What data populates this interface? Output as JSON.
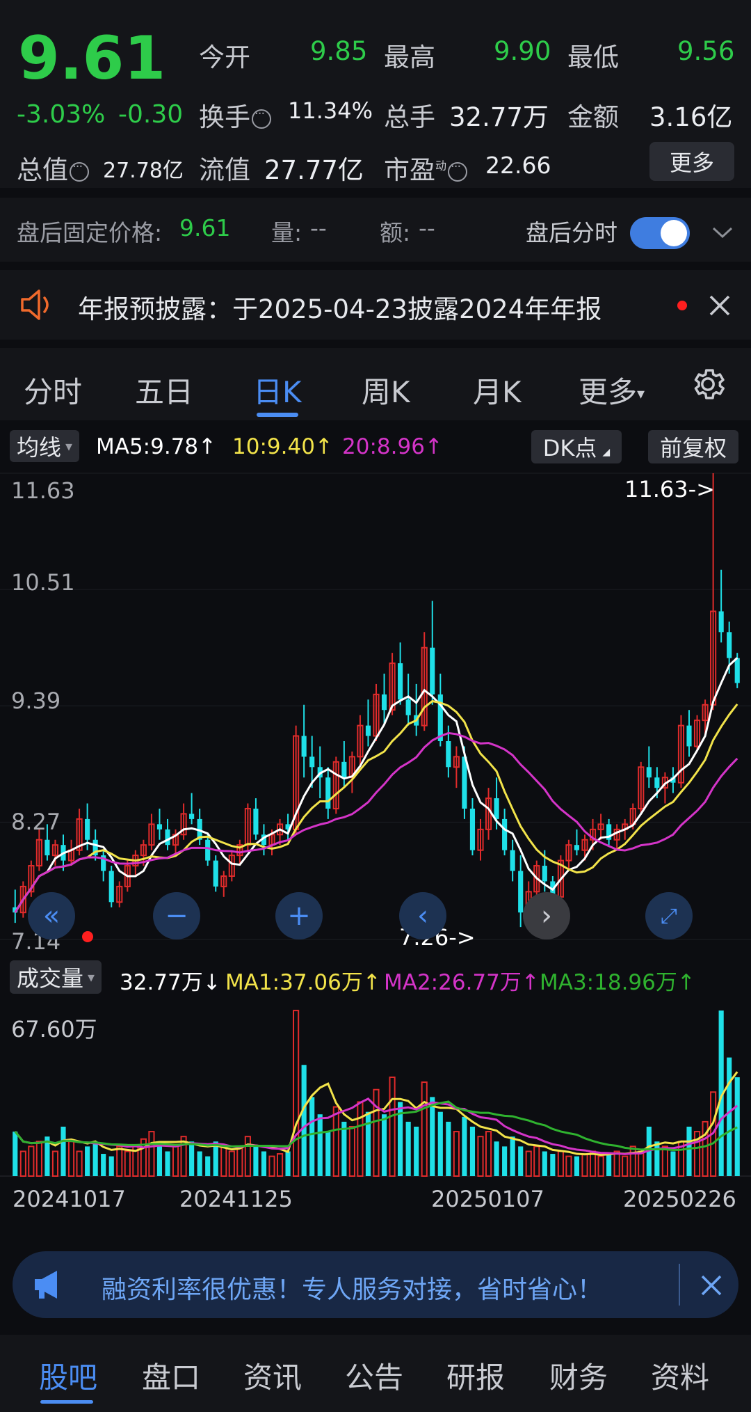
{
  "quote": {
    "price": "9.61",
    "change_pct": "-3.03%",
    "change_amt": "-0.30",
    "open_label": "今开",
    "open": "9.85",
    "high_label": "最高",
    "high": "9.90",
    "low_label": "最低",
    "low": "9.56",
    "turnover_label": "换手",
    "turnover": "11.34%",
    "volume_label": "总手",
    "volume": "32.77万",
    "amount_label": "金额",
    "amount": "3.16亿",
    "mktcap_label": "总值",
    "mktcap": "27.78亿",
    "float_label": "流值",
    "float": "27.77亿",
    "pe_label": "市盈",
    "pe_sup": "动",
    "pe": "22.66",
    "more_label": "更多"
  },
  "afterhours": {
    "price_label": "盘后固定价格:",
    "price": "9.61",
    "vol_label": "量:",
    "vol": "--",
    "amt_label": "额:",
    "amt": "--",
    "toggle_label": "盘后分时",
    "toggle_on": true
  },
  "notice": {
    "text": "年报预披露：于2025-04-23披露2024年年报"
  },
  "tabs": [
    {
      "label": "分时"
    },
    {
      "label": "五日"
    },
    {
      "label": "日K",
      "active": true
    },
    {
      "label": "周K"
    },
    {
      "label": "月K"
    },
    {
      "label": "更多"
    }
  ],
  "chart_controls": {
    "indicator_select": "均线",
    "ma5": "MA5:9.78",
    "ma10": "10:9.40",
    "ma20": "20:8.96",
    "dk_label": "DK点",
    "adjust_label": "前复权",
    "volume_select": "成交量",
    "vol_now": "32.77万",
    "vol_ma1": "MA1:37.06万",
    "vol_ma2": "MA2:26.77万",
    "vol_ma3": "MA3:18.96万"
  },
  "colors": {
    "up": "#e02b2b",
    "down": "#1fe0e8",
    "ma5": "#ffffff",
    "ma10": "#f2e34a",
    "ma20": "#d434c8",
    "vol_ma3": "#2fb22f",
    "accent": "#4b8df3",
    "price_down": "#2ecc4a"
  },
  "chart_data": {
    "type": "candlestick",
    "price_axis": {
      "ticks": [
        "11.63",
        "10.51",
        "9.39",
        "8.27",
        "7.14"
      ],
      "ylim": [
        7.14,
        11.63
      ]
    },
    "max_marker": "11.63->",
    "min_marker": "7.26->",
    "volume_axis": {
      "ticks": [
        "67.60万"
      ],
      "ylim": [
        0,
        67.6
      ]
    },
    "date_labels": [
      "20241017",
      "20241125",
      "20250107",
      "20250226"
    ],
    "candles_ohlc": [
      [
        7.45,
        7.62,
        7.3,
        7.4
      ],
      [
        7.4,
        7.7,
        7.35,
        7.65
      ],
      [
        7.6,
        7.9,
        7.55,
        7.85
      ],
      [
        7.85,
        8.2,
        7.8,
        8.1
      ],
      [
        8.1,
        8.25,
        7.9,
        7.95
      ],
      [
        7.95,
        8.1,
        7.85,
        8.05
      ],
      [
        8.05,
        8.15,
        7.8,
        7.9
      ],
      [
        7.9,
        8.1,
        7.85,
        8.0
      ],
      [
        8.0,
        8.4,
        7.95,
        8.3
      ],
      [
        8.3,
        8.45,
        8.0,
        8.1
      ],
      [
        8.1,
        8.2,
        7.9,
        7.95
      ],
      [
        7.95,
        8.0,
        7.7,
        7.8
      ],
      [
        7.8,
        7.85,
        7.45,
        7.5
      ],
      [
        7.5,
        7.7,
        7.45,
        7.65
      ],
      [
        7.65,
        7.9,
        7.6,
        7.85
      ],
      [
        7.85,
        8.0,
        7.75,
        7.95
      ],
      [
        7.95,
        8.1,
        7.85,
        8.05
      ],
      [
        8.05,
        8.35,
        8.0,
        8.25
      ],
      [
        8.25,
        8.4,
        8.1,
        8.2
      ],
      [
        8.2,
        8.3,
        8.0,
        8.05
      ],
      [
        8.05,
        8.2,
        7.95,
        8.15
      ],
      [
        8.15,
        8.45,
        8.1,
        8.35
      ],
      [
        8.35,
        8.55,
        8.25,
        8.3
      ],
      [
        8.3,
        8.4,
        8.05,
        8.1
      ],
      [
        8.1,
        8.15,
        7.85,
        7.9
      ],
      [
        7.9,
        7.95,
        7.6,
        7.65
      ],
      [
        7.65,
        7.8,
        7.55,
        7.75
      ],
      [
        7.75,
        8.0,
        7.7,
        7.95
      ],
      [
        7.95,
        8.1,
        7.85,
        8.05
      ],
      [
        8.05,
        8.45,
        8.0,
        8.4
      ],
      [
        8.4,
        8.5,
        8.1,
        8.15
      ],
      [
        8.15,
        8.25,
        7.95,
        8.05
      ],
      [
        8.05,
        8.2,
        7.95,
        8.15
      ],
      [
        8.15,
        8.3,
        8.05,
        8.25
      ],
      [
        8.25,
        8.35,
        8.1,
        8.2
      ],
      [
        8.2,
        9.2,
        8.15,
        9.1
      ],
      [
        9.1,
        9.4,
        8.7,
        8.9
      ],
      [
        8.9,
        9.1,
        8.6,
        8.8
      ],
      [
        8.8,
        9.0,
        8.5,
        8.7
      ],
      [
        8.7,
        8.8,
        8.3,
        8.4
      ],
      [
        8.4,
        8.9,
        8.35,
        8.85
      ],
      [
        8.85,
        9.05,
        8.6,
        8.7
      ],
      [
        8.7,
        8.95,
        8.55,
        8.9
      ],
      [
        8.9,
        9.3,
        8.8,
        9.2
      ],
      [
        9.2,
        9.45,
        9.0,
        9.1
      ],
      [
        9.1,
        9.6,
        9.05,
        9.5
      ],
      [
        9.5,
        9.7,
        9.2,
        9.35
      ],
      [
        9.35,
        9.9,
        9.3,
        9.8
      ],
      [
        9.8,
        10.0,
        9.4,
        9.45
      ],
      [
        9.45,
        9.7,
        9.2,
        9.3
      ],
      [
        9.3,
        9.6,
        9.1,
        9.2
      ],
      [
        9.2,
        10.1,
        9.15,
        9.95
      ],
      [
        9.95,
        10.4,
        9.4,
        9.5
      ],
      [
        9.5,
        9.7,
        9.0,
        9.05
      ],
      [
        9.05,
        9.2,
        8.7,
        8.8
      ],
      [
        8.8,
        9.0,
        8.6,
        8.9
      ],
      [
        8.9,
        9.0,
        8.3,
        8.4
      ],
      [
        8.4,
        8.5,
        7.95,
        8.0
      ],
      [
        8.0,
        8.3,
        7.9,
        8.2
      ],
      [
        8.2,
        8.6,
        8.1,
        8.5
      ],
      [
        8.5,
        8.7,
        8.2,
        8.3
      ],
      [
        8.3,
        8.4,
        7.95,
        8.0
      ],
      [
        8.0,
        8.1,
        7.7,
        7.8
      ],
      [
        7.8,
        7.95,
        7.26,
        7.4
      ],
      [
        7.4,
        7.7,
        7.3,
        7.6
      ],
      [
        7.6,
        7.9,
        7.5,
        7.85
      ],
      [
        7.85,
        8.0,
        7.6,
        7.7
      ],
      [
        7.7,
        7.75,
        7.45,
        7.55
      ],
      [
        7.55,
        7.95,
        7.5,
        7.9
      ],
      [
        7.9,
        8.1,
        7.8,
        8.05
      ],
      [
        8.05,
        8.2,
        7.95,
        8.0
      ],
      [
        8.0,
        8.15,
        7.9,
        8.1
      ],
      [
        8.1,
        8.3,
        8.0,
        8.2
      ],
      [
        8.2,
        8.35,
        8.1,
        8.25
      ],
      [
        8.25,
        8.3,
        8.05,
        8.1
      ],
      [
        8.1,
        8.25,
        8.0,
        8.2
      ],
      [
        8.2,
        8.3,
        8.1,
        8.25
      ],
      [
        8.25,
        8.45,
        8.2,
        8.4
      ],
      [
        8.4,
        8.85,
        8.35,
        8.8
      ],
      [
        8.8,
        9.0,
        8.6,
        8.7
      ],
      [
        8.7,
        8.8,
        8.5,
        8.6
      ],
      [
        8.6,
        8.75,
        8.45,
        8.7
      ],
      [
        8.7,
        8.8,
        8.55,
        8.65
      ],
      [
        8.65,
        9.3,
        8.6,
        9.2
      ],
      [
        9.2,
        9.35,
        8.9,
        9.0
      ],
      [
        9.0,
        9.3,
        8.95,
        9.25
      ],
      [
        9.25,
        9.45,
        9.1,
        9.4
      ],
      [
        9.4,
        11.63,
        9.35,
        10.3
      ],
      [
        10.3,
        10.7,
        10.0,
        10.1
      ],
      [
        10.1,
        10.2,
        9.7,
        9.85
      ],
      [
        9.85,
        9.9,
        9.56,
        9.61
      ]
    ],
    "volume": [
      18,
      10,
      12,
      14,
      16,
      10,
      20,
      14,
      10,
      12,
      14,
      9,
      8,
      12,
      10,
      12,
      15,
      18,
      14,
      10,
      12,
      16,
      14,
      10,
      8,
      14,
      12,
      10,
      12,
      16,
      12,
      10,
      8,
      9,
      10,
      67,
      45,
      32,
      25,
      18,
      28,
      22,
      20,
      30,
      26,
      35,
      25,
      40,
      30,
      22,
      20,
      38,
      32,
      26,
      22,
      18,
      24,
      20,
      16,
      18,
      14,
      12,
      16,
      12,
      10,
      12,
      10,
      9,
      10,
      8,
      8,
      9,
      10,
      8,
      9,
      10,
      8,
      12,
      10,
      20,
      14,
      12,
      10,
      14,
      20,
      18,
      22,
      34,
      67,
      48,
      40
    ],
    "ma_lines": {
      "ma5_last": 9.78,
      "ma10_last": 9.4,
      "ma20_last": 8.96
    }
  },
  "banner": {
    "text": "融资利率很优惠！专人服务对接，省时省心！"
  },
  "bottom_nav": [
    {
      "label": "股吧",
      "active": true
    },
    {
      "label": "盘口"
    },
    {
      "label": "资讯"
    },
    {
      "label": "公告"
    },
    {
      "label": "研报"
    },
    {
      "label": "财务"
    },
    {
      "label": "资料"
    }
  ]
}
